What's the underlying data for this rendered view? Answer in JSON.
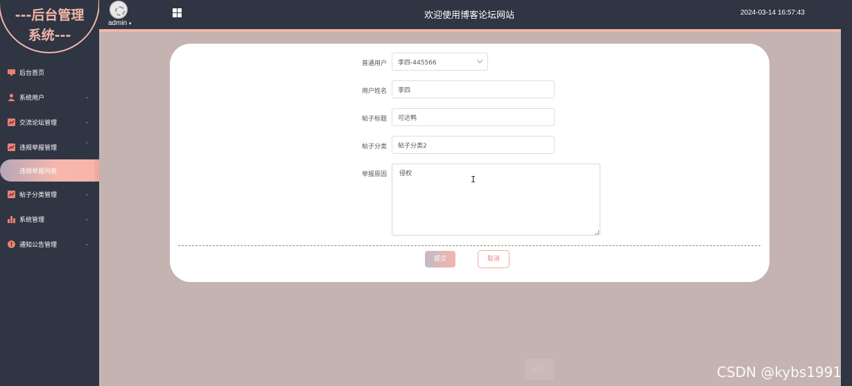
{
  "brand": {
    "line1": "---后台管理",
    "line2": "系统---"
  },
  "header": {
    "username": "admin",
    "site_title": "欢迎使用博客论坛网站",
    "datetime": "2024-03-14 16:57:43"
  },
  "sidebar": {
    "items": [
      {
        "label": "后台首页",
        "icon": "monitor-icon"
      },
      {
        "label": "系统用户",
        "icon": "user-icon"
      },
      {
        "label": "交流论坛管理",
        "icon": "chart-icon"
      },
      {
        "label": "违规举报管理",
        "icon": "chart-icon"
      },
      {
        "label": "违规举报列表",
        "icon": ""
      },
      {
        "label": "帖子分类管理",
        "icon": "chart-icon"
      },
      {
        "label": "系统管理",
        "icon": "bar-chart-icon"
      },
      {
        "label": "通知公告管理",
        "icon": "info-icon"
      }
    ]
  },
  "form": {
    "fields": [
      {
        "label": "普通用户",
        "value": "李四-445566",
        "type": "select"
      },
      {
        "label": "用户姓名",
        "value": "李四",
        "type": "input"
      },
      {
        "label": "帖子标题",
        "value": "可达鸭",
        "type": "input"
      },
      {
        "label": "帖子分类",
        "value": "帖子分类2",
        "type": "input"
      },
      {
        "label": "举报原因",
        "value": "侵权",
        "type": "textarea"
      }
    ],
    "submit_label": "提交",
    "cancel_label": "取消"
  },
  "background_button_label": "返回",
  "watermark": "CSDN @kybs1991",
  "colors": {
    "sidebar_bg": "#2f3542",
    "accent": "#f3b5aa",
    "main_bg": "#c4b3b1",
    "card_bg": "#ffffff"
  }
}
